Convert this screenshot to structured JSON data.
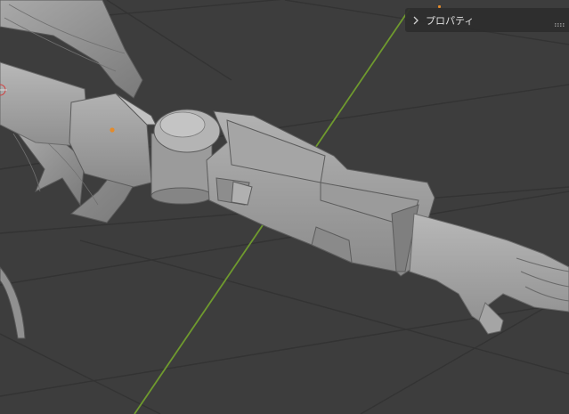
{
  "properties_panel": {
    "label": "プロパティ",
    "expand_icon": "chevron-right-icon",
    "grip_icon": "drag-grip-icon"
  },
  "viewport": {
    "background_color": "#3d3d3d",
    "y_axis_color": "#6f9a2e",
    "origin_marker_color": "#e38b2c",
    "model_color": "#9a9a9a"
  }
}
